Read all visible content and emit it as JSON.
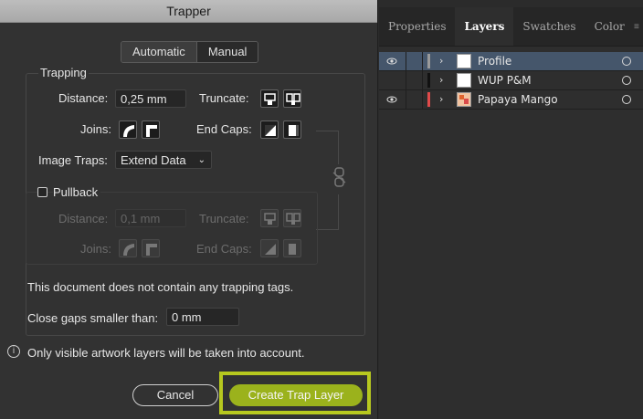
{
  "dialog": {
    "title": "Trapper",
    "tabs": [
      {
        "label": "Automatic",
        "active": true
      },
      {
        "label": "Manual",
        "active": false
      }
    ],
    "trapping": {
      "legend": "Trapping",
      "distance_label": "Distance:",
      "distance_value": "0,25 mm",
      "truncate_label": "Truncate:",
      "joins_label": "Joins:",
      "end_caps_label": "End Caps:",
      "image_traps_label": "Image Traps:",
      "image_traps_value": "Extend Data"
    },
    "pullback": {
      "label": "Pullback",
      "checked": false,
      "distance_label": "Distance:",
      "distance_value": "0,1 mm",
      "truncate_label": "Truncate:",
      "joins_label": "Joins:",
      "end_caps_label": "End Caps:"
    },
    "no_tags_message": "This document does not contain any trapping tags.",
    "close_gaps_label": "Close gaps smaller than:",
    "close_gaps_value": "0 mm",
    "info_message": "Only visible artwork layers will be taken into account.",
    "cancel_label": "Cancel",
    "create_label": "Create Trap Layer",
    "accent_color": "#9bb21c",
    "highlight_color": "#b7c81f"
  },
  "layers_panel": {
    "tabs": [
      {
        "label": "Properties",
        "active": false
      },
      {
        "label": "Layers",
        "active": true
      },
      {
        "label": "Swatches",
        "active": false
      },
      {
        "label": "Color",
        "active": false
      }
    ],
    "menu_icon": "panel-menu-icon",
    "layers": [
      {
        "name": "Profile",
        "visible": true,
        "selected": true,
        "color": "#9a9a9a"
      },
      {
        "name": "WUP P&M",
        "visible": false,
        "selected": false,
        "color": "#111111"
      },
      {
        "name": "Papaya Mango",
        "visible": true,
        "selected": false,
        "color": "#e04a4a"
      }
    ]
  }
}
